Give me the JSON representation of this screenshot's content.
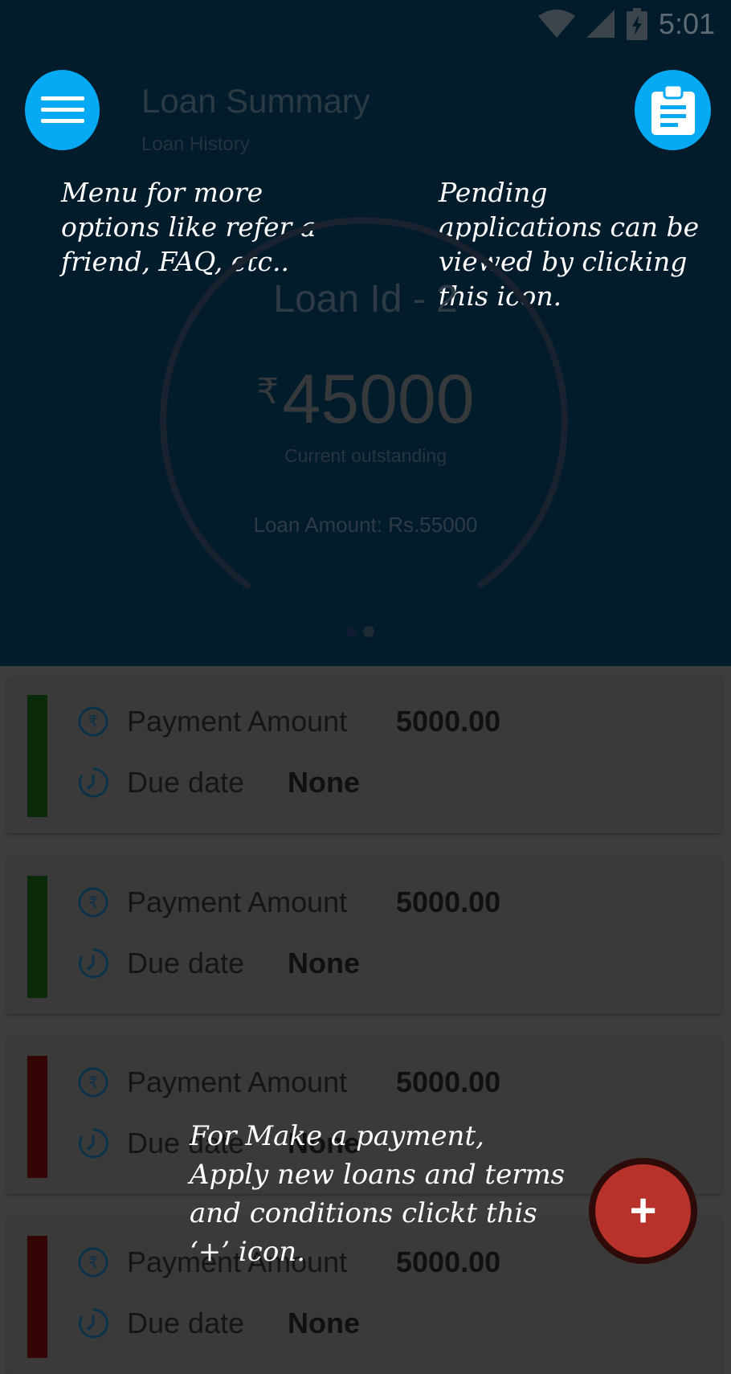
{
  "status_bar": {
    "time": "5:01"
  },
  "header": {
    "title": "Loan Summary",
    "subtitle": "Loan History"
  },
  "icons": {
    "menu": "menu-icon",
    "pending": "clipboard-icon",
    "fab": "plus-icon"
  },
  "hints": {
    "menu": "Menu for more options like refer a friend, FAQ, etc..",
    "pending": "Pending applications can be viewed by clicking this icon.",
    "fab": "For Make a payment, Apply new loans and terms and conditions clickt this ‘+’ icon."
  },
  "loan": {
    "id_label": "Loan Id - 2",
    "currency_symbol": "₹",
    "outstanding_value": "45000",
    "outstanding_label": "Current outstanding",
    "loan_amount_text": "Loan Amount: Rs.55000"
  },
  "pager": {
    "pages": 2,
    "current": 1
  },
  "payments": [
    {
      "amount_label": "Payment Amount",
      "amount": "5000.00",
      "due_label": "Due date",
      "due": "None",
      "status_color": "#0a2a0a"
    },
    {
      "amount_label": "Payment Amount",
      "amount": "5000.00",
      "due_label": "Due date",
      "due": "None",
      "status_color": "#0a2a0a"
    },
    {
      "amount_label": "Payment Amount",
      "amount": "5000.00",
      "due_label": "Due date",
      "due": "None",
      "status_color": "#330505"
    },
    {
      "amount_label": "Payment Amount",
      "amount": "5000.00",
      "due_label": "Due date",
      "due": "None",
      "status_color": "#330505"
    }
  ],
  "colors": {
    "header_bg": "#021c2c",
    "accent": "#06a9f4",
    "fab": "#b7322b"
  }
}
